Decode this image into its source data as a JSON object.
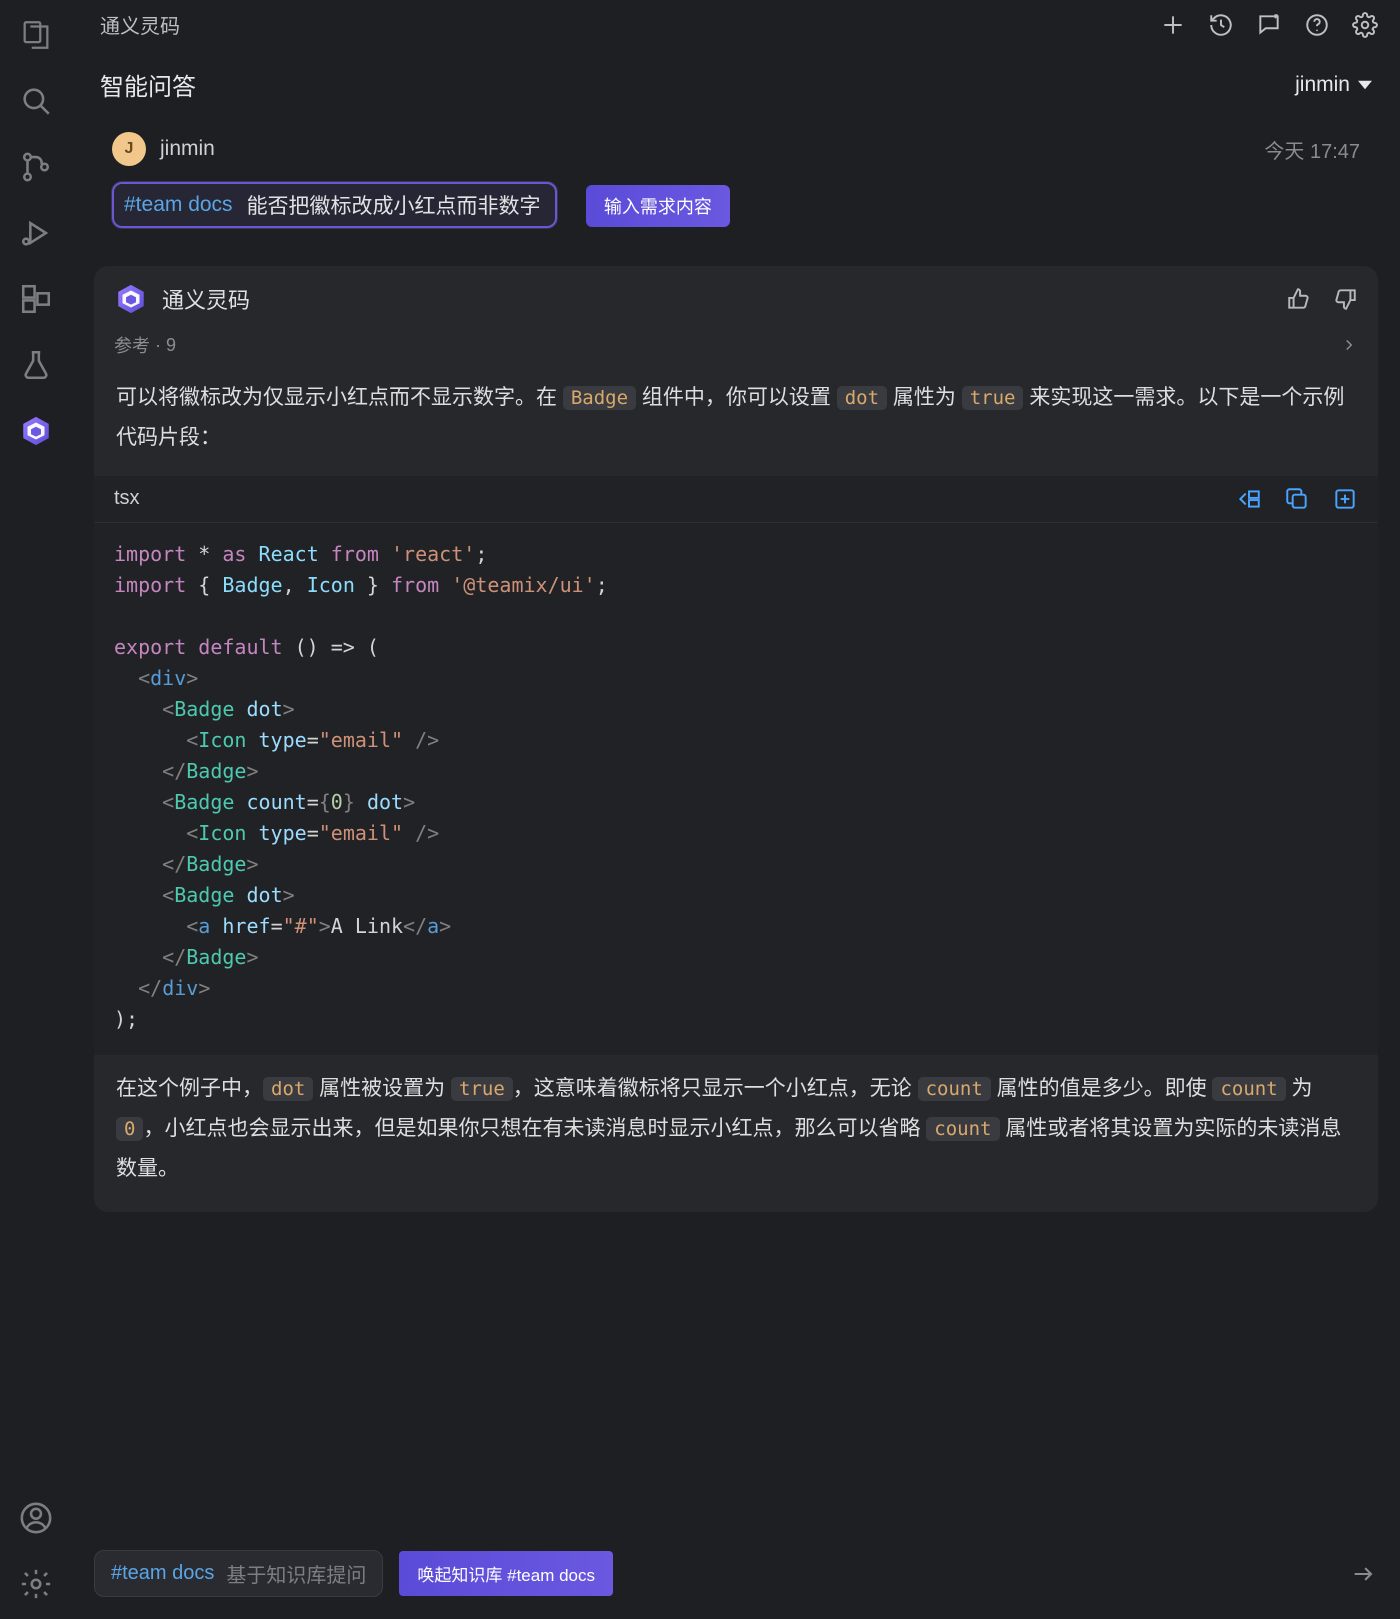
{
  "panel": {
    "title": "通义灵码",
    "subheader": "智能问答",
    "user": "jinmin"
  },
  "user_msg": {
    "avatar_initial": "J",
    "name": "jinmin",
    "timestamp": "今天 17:47",
    "tag": "#team docs",
    "text": "能否把徽标改成小红点而非数字",
    "annotation": "输入需求内容"
  },
  "ai_msg": {
    "name": "通义灵码",
    "ref_label": "参考",
    "ref_count": "9",
    "p1_a": "可以将徽标改为仅显示小红点而不显示数字。在 ",
    "p1_code1": "Badge",
    "p1_b": " 组件中，你可以设置 ",
    "p1_code2": "dot",
    "p1_c": " 属性为 ",
    "p1_code3": "true",
    "p1_d": " 来实现这一需求。以下是一个示例代码片段：",
    "code_lang": "tsx",
    "code": {
      "l1": {
        "kw1": "import",
        "op": "*",
        "kw2": "as",
        "id": "React",
        "kw3": "from",
        "str": "'react'",
        "semi": ";"
      },
      "l2": {
        "kw1": "import",
        "lb": "{",
        "id1": "Badge",
        "comma": ",",
        "id2": "Icon",
        "rb": "}",
        "kw2": "from",
        "str": "'@teamix/ui'",
        "semi": ";"
      },
      "l3": "",
      "l4": {
        "kw1": "export",
        "kw2": "default",
        "par": "() => ("
      },
      "l5": {
        "lt": "<",
        "tag": "div",
        "gt": ">"
      },
      "l6": {
        "lt": "<",
        "tag": "Badge",
        "attr": "dot",
        "gt": ">"
      },
      "l7": {
        "lt": "<",
        "tag": "Icon",
        "attr": "type",
        "eq": "=",
        "str": "\"email\"",
        "sc": " />"
      },
      "l8": {
        "lt": "</",
        "tag": "Badge",
        "gt": ">"
      },
      "l9": {
        "lt": "<",
        "tag": "Badge",
        "attr1": "count",
        "eq": "=",
        "lb": "{",
        "num": "0",
        "rb": "}",
        "attr2": "dot",
        "gt": ">"
      },
      "l10": {
        "lt": "<",
        "tag": "Icon",
        "attr": "type",
        "eq": "=",
        "str": "\"email\"",
        "sc": " />"
      },
      "l11": {
        "lt": "</",
        "tag": "Badge",
        "gt": ">"
      },
      "l12": {
        "lt": "<",
        "tag": "Badge",
        "attr": "dot",
        "gt": ">"
      },
      "l13": {
        "lt": "<",
        "tag": "a",
        "attr": "href",
        "eq": "=",
        "str": "\"#\"",
        "gt": ">",
        "txt": "A Link",
        "lt2": "</",
        "tag2": "a",
        "gt2": ">"
      },
      "l14": {
        "lt": "</",
        "tag": "Badge",
        "gt": ">"
      },
      "l15": {
        "lt": "</",
        "tag": "div",
        "gt": ">"
      },
      "l16": ");"
    },
    "p2_a": "在这个例子中，",
    "p2_code1": "dot",
    "p2_b": " 属性被设置为 ",
    "p2_code2": "true",
    "p2_c": "，这意味着徽标将只显示一个小红点，无论 ",
    "p2_code3": "count",
    "p2_d": " 属性的值是多少。即使 ",
    "p2_code4": "count",
    "p2_e": " 为 ",
    "p2_code5": "0",
    "p2_f": "，小红点也会显示出来，但是如果你只想在有未读消息时显示小红点，那么可以省略 ",
    "p2_code6": "count",
    "p2_g": " 属性或者将其设置为实际的未读消息数量。"
  },
  "input": {
    "tag": "#team docs",
    "placeholder": "基于知识库提问",
    "annotation": "唤起知识库 #team docs"
  }
}
